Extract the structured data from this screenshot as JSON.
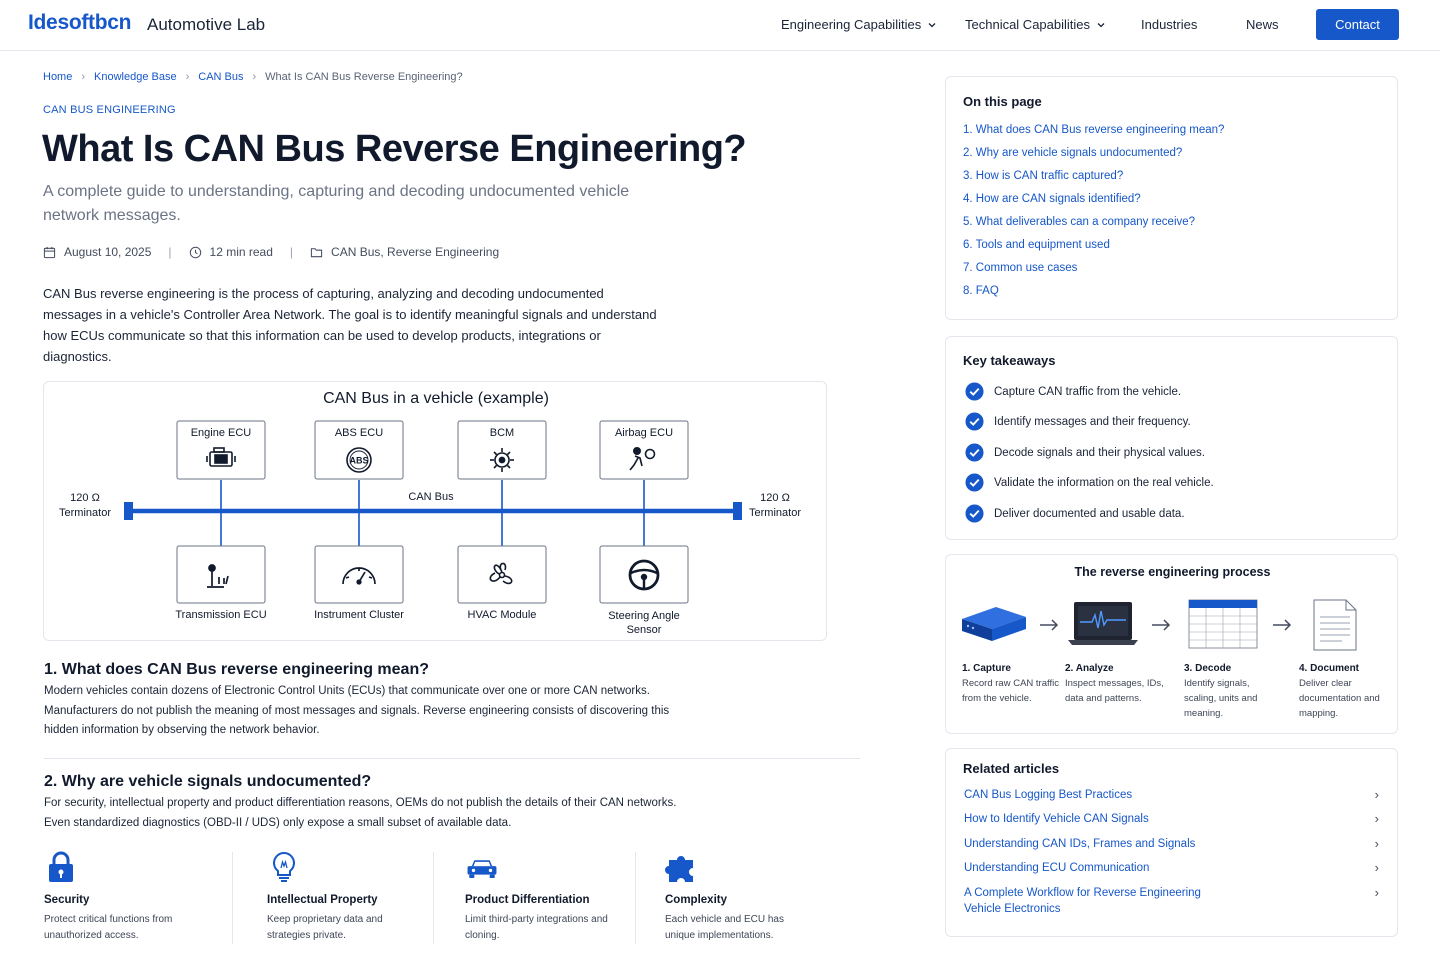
{
  "header": {
    "logo": "Idesoftbcn",
    "logo_sub": "Automotive Lab",
    "nav": [
      {
        "label": "Engineering Capabilities",
        "dropdown": true
      },
      {
        "label": "Technical Capabilities",
        "dropdown": true
      },
      {
        "label": "Industries",
        "dropdown": false
      },
      {
        "label": "News",
        "dropdown": false
      }
    ],
    "contact_label": "Contact"
  },
  "breadcrumb": [
    "Home",
    "Knowledge Base",
    "CAN Bus",
    "What Is CAN Bus Reverse Engineering?"
  ],
  "article": {
    "category": "CAN BUS ENGINEERING",
    "title": "What Is CAN Bus Reverse Engineering?",
    "subtitle": "A complete guide to understanding, capturing and decoding undocumented vehicle network messages.",
    "meta": {
      "date": "August 10, 2025",
      "read_time": "12 min read",
      "tags": "CAN Bus, Reverse Engineering"
    },
    "intro": "CAN Bus reverse engineering is the process of capturing, analyzing and decoding undocumented messages in a vehicle's Controller Area Network. The goal is to identify meaningful signals and understand how ECUs communicate so that this information can be used to develop products, integrations or diagnostics.",
    "diagram": {
      "title": "CAN Bus in a vehicle (example)",
      "bus_label": "CAN Bus",
      "terminator_left": [
        "120 Ω",
        "Terminator"
      ],
      "terminator_right": [
        "120 Ω",
        "Terminator"
      ],
      "top_ecus": [
        "Engine ECU",
        "ABS ECU",
        "BCM",
        "Airbag ECU"
      ],
      "bottom_ecus": [
        "Transmission ECU",
        "Instrument Cluster",
        "HVAC Module",
        "Steering Angle\nSensor"
      ],
      "abs_text": "ABS",
      "accent": "#1657c9"
    },
    "sections": [
      {
        "heading": "1. What does CAN Bus reverse engineering mean?",
        "body": "Modern vehicles contain dozens of Electronic Control Units (ECUs) that communicate over one or more CAN networks. Manufacturers do not publish the meaning of most messages and signals. Reverse engineering consists of discovering this hidden information by observing the network behavior."
      },
      {
        "heading": "2.  Why are vehicle signals undocumented?",
        "body": "For security, intellectual property and product differentiation reasons, OEMs do not publish the details of their CAN networks. Even standardized diagnostics (OBD-II / UDS) only expose a small subset of available data."
      }
    ],
    "features": [
      {
        "icon": "lock-icon",
        "title": "Security",
        "desc": "Protect critical functions from unauthorized access."
      },
      {
        "icon": "lightbulb-icon",
        "title": "Intellectual Property",
        "desc": "Keep proprietary data and strategies private."
      },
      {
        "icon": "car-icon",
        "title": "Product Differentiation",
        "desc": "Limit third-party integrations and cloning."
      },
      {
        "icon": "puzzle-icon",
        "title": "Complexity",
        "desc": "Each vehicle and ECU has unique implementations."
      }
    ]
  },
  "sidebar": {
    "toc": {
      "title": "On this page",
      "items": [
        "1.  What does CAN Bus reverse engineering mean?",
        "2.  Why are vehicle signals undocumented?",
        "3.  How is CAN traffic captured?",
        "4.  How are CAN signals identified?",
        "5.  What deliverables can a company receive?",
        "6.  Tools and equipment used",
        "7.  Common use cases",
        "8.  FAQ"
      ]
    },
    "takeaways": {
      "title": "Key takeaways",
      "items": [
        "Capture CAN traffic from the vehicle.",
        "Identify messages and their frequency.",
        "Decode signals and their physical values.",
        "Validate the information on the real vehicle.",
        "Deliver documented and usable data."
      ]
    },
    "process": {
      "title": "The reverse engineering process",
      "steps": [
        {
          "title": "1. Capture",
          "desc": "Record raw CAN traffic from the vehicle."
        },
        {
          "title": "2. Analyze",
          "desc": "Inspect messages, IDs, data and patterns."
        },
        {
          "title": "3. Decode",
          "desc": "Identify signals, scaling, units and meaning."
        },
        {
          "title": "4. Document",
          "desc": "Deliver clear documentation and mapping."
        }
      ]
    },
    "related": {
      "title": "Related articles",
      "items": [
        "CAN Bus Logging Best Practices",
        "How to Identify Vehicle CAN Signals",
        "Understanding CAN IDs, Frames and Signals",
        "Understanding ECU Communication",
        "A Complete Workflow for Reverse Engineering Vehicle Electronics"
      ]
    }
  }
}
